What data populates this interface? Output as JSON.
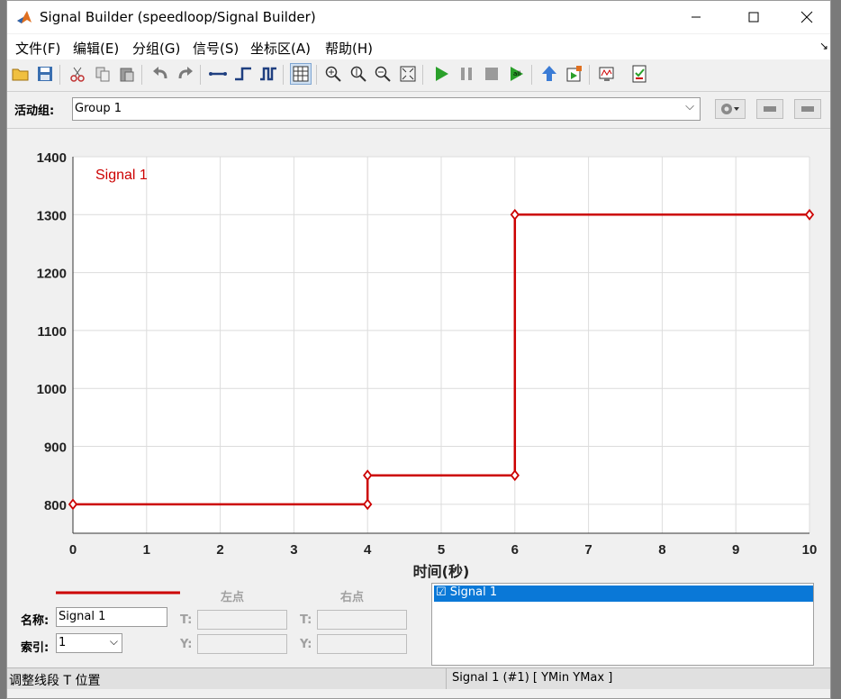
{
  "window": {
    "title": "Signal Builder (speedloop/Signal Builder)"
  },
  "menu": [
    {
      "label": "文件(F)"
    },
    {
      "label": "编辑(E)"
    },
    {
      "label": "分组(G)"
    },
    {
      "label": "信号(S)"
    },
    {
      "label": "坐标区(A)"
    },
    {
      "label": "帮助(H)"
    }
  ],
  "menu_overflow": "↘",
  "group": {
    "label": "活动组:",
    "value": "Group 1"
  },
  "chart_data": {
    "type": "line",
    "xlabel": "时间(秒)",
    "ylabel": "",
    "xlim": [
      0,
      10
    ],
    "ylim": [
      750,
      1400
    ],
    "xticks": [
      "0",
      "1",
      "2",
      "3",
      "4",
      "5",
      "6",
      "7",
      "8",
      "9",
      "10"
    ],
    "yticks": [
      "800",
      "900",
      "1000",
      "1100",
      "1200",
      "1300",
      "1400"
    ],
    "grid": true,
    "series": [
      {
        "name": "Signal 1",
        "color": "#cc0000",
        "x": [
          0,
          4,
          4,
          6,
          6,
          10
        ],
        "y": [
          800,
          800,
          850,
          850,
          1300,
          1300
        ]
      }
    ]
  },
  "panel": {
    "name_label": "名称:",
    "name_value": "Signal 1",
    "index_label": "索引:",
    "index_value": "1",
    "left_point": "左点",
    "right_point": "右点",
    "t_label": "T:",
    "y_label": "Y:"
  },
  "signal_list": {
    "item": "☑ Signal 1"
  },
  "status": {
    "left": "调整线段 T 位置",
    "right": "Signal 1 (#1)  [ YMin YMax ]"
  }
}
